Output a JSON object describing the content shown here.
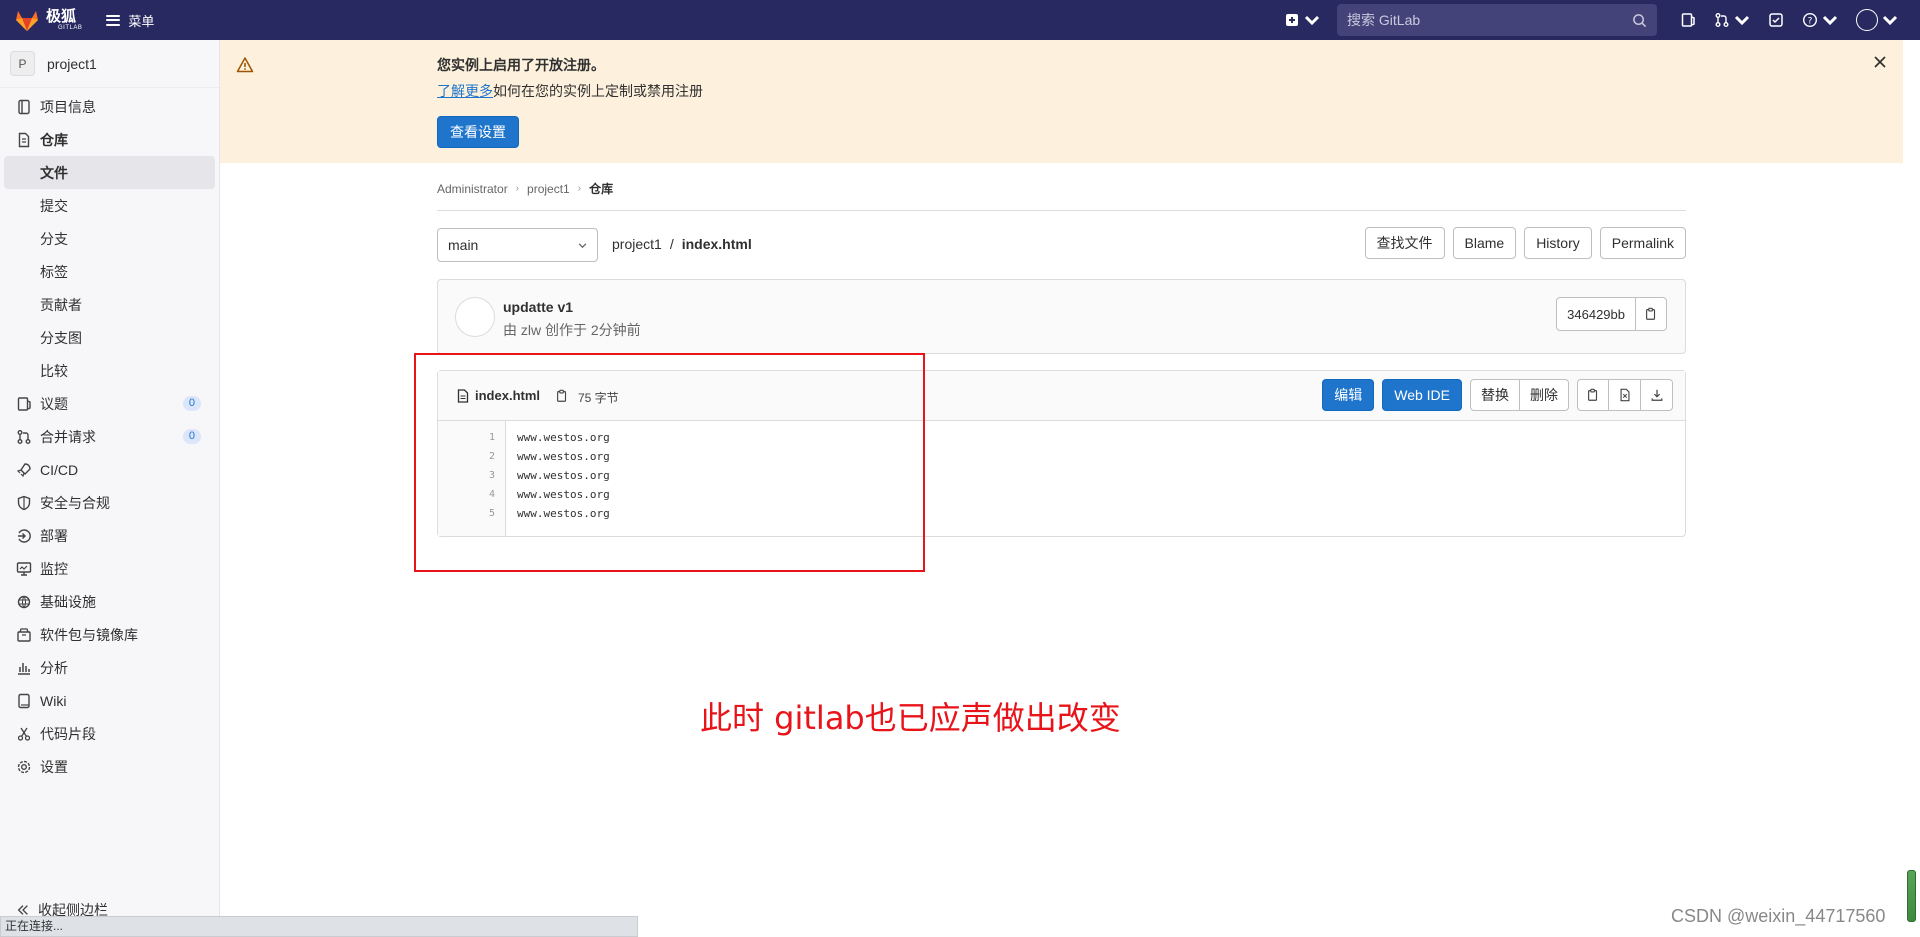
{
  "topbar": {
    "logo_text": "极狐",
    "logo_sub": "GITLAB",
    "menu_label": "菜单",
    "search_placeholder": "搜索 GitLab",
    "icons": [
      "new-item-icon",
      "issues-icon",
      "merge-request-icon",
      "todo-icon",
      "help-icon",
      "user-avatar-icon"
    ]
  },
  "sidebar": {
    "project_initial": "P",
    "project_name": "project1",
    "items": [
      {
        "label": "项目信息",
        "icon": "info-icon"
      },
      {
        "label": "仓库",
        "icon": "repository-icon"
      },
      {
        "label": "文件"
      },
      {
        "label": "提交"
      },
      {
        "label": "分支"
      },
      {
        "label": "标签"
      },
      {
        "label": "贡献者"
      },
      {
        "label": "分支图"
      },
      {
        "label": "比较"
      },
      {
        "label": "议题",
        "icon": "issues-icon",
        "count": "0"
      },
      {
        "label": "合并请求",
        "icon": "merge-request-icon",
        "count": "0"
      },
      {
        "label": "CI/CD",
        "icon": "rocket-icon"
      },
      {
        "label": "安全与合规",
        "icon": "shield-icon"
      },
      {
        "label": "部署",
        "icon": "deploy-icon"
      },
      {
        "label": "监控",
        "icon": "monitor-icon"
      },
      {
        "label": "基础设施",
        "icon": "infrastructure-icon"
      },
      {
        "label": "软件包与镜像库",
        "icon": "package-icon"
      },
      {
        "label": "分析",
        "icon": "chart-icon"
      },
      {
        "label": "Wiki",
        "icon": "book-icon"
      },
      {
        "label": "代码片段",
        "icon": "snippet-icon"
      },
      {
        "label": "设置",
        "icon": "settings-icon"
      }
    ],
    "collapse_label": "收起侧边栏"
  },
  "statusbar": "正在连接...",
  "banner": {
    "title": "您实例上启用了开放注册。",
    "link": "了解更多",
    "text": "如何在您的实例上定制或禁用注册",
    "button": "查看设置"
  },
  "breadcrumb": [
    "Administrator",
    "project1",
    "仓库"
  ],
  "file_nav": {
    "branch": "main",
    "path_project": "project1",
    "path_file": "index.html",
    "buttons": [
      "查找文件",
      "Blame",
      "History",
      "Permalink"
    ]
  },
  "commit": {
    "title": "updatte v1",
    "meta": "由 zlw 创作于 2分钟前",
    "sha": "346429bb"
  },
  "file": {
    "name": "index.html",
    "size": "75 字节",
    "edit": "编辑",
    "webide": "Web IDE",
    "replace": "替换",
    "delete": "删除",
    "lines": [
      "www.westos.org",
      "www.westos.org",
      "www.westos.org",
      "www.westos.org",
      "www.westos.org"
    ],
    "line_numbers": [
      "1",
      "2",
      "3",
      "4",
      "5"
    ]
  },
  "annotation": "此时 gitlab也已应声做出改变",
  "watermark": "CSDN @weixin_44717560",
  "colors": {
    "navbar": "#292961",
    "accent": "#1f75cb",
    "annotation": "#e8141a",
    "banner": "#fdf1dd"
  }
}
